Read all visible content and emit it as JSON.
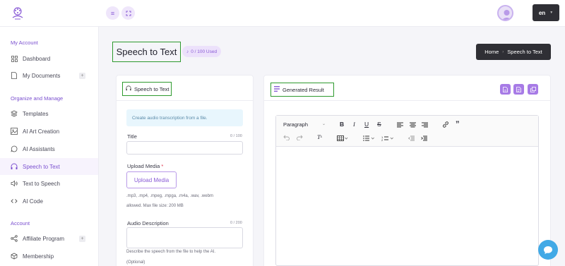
{
  "topbar": {
    "language": "en"
  },
  "sidebar": {
    "sections": [
      {
        "title": "My Account"
      },
      {
        "title": "Organize and Manage"
      },
      {
        "title": "Account"
      }
    ],
    "items": [
      {
        "label": "Dashboard",
        "icon": "grid-icon"
      },
      {
        "label": "My Documents",
        "icon": "document-icon",
        "expandable": true
      },
      {
        "label": "Templates",
        "icon": "layers-icon"
      },
      {
        "label": "AI Art Creation",
        "icon": "image-icon"
      },
      {
        "label": "AI Assistants",
        "icon": "chat-icon"
      },
      {
        "label": "Speech to Text",
        "icon": "headphones-icon",
        "active": true
      },
      {
        "label": "Text to Speech",
        "icon": "speaker-icon"
      },
      {
        "label": "AI Code",
        "icon": "code-icon"
      },
      {
        "label": "Affiliate Program",
        "icon": "share-icon",
        "expandable": true
      },
      {
        "label": "Membership",
        "icon": "box-icon"
      }
    ]
  },
  "header": {
    "title": "Speech to Text",
    "usage": "0 / 100 Used",
    "breadcrumb": {
      "home": "Home",
      "current": "Speech to Text"
    }
  },
  "form": {
    "card_title": "Speech to Text",
    "info": "Create audio transcription from a file.",
    "title_label": "Title",
    "title_counter": "0 / 100",
    "title_value": "",
    "upload_label": "Upload Media",
    "upload_required": "*",
    "upload_button": "Upload Media",
    "formats_hint": ".mp3, .mp4, .mpeg, .mpga, .m4a, .wav, .webm",
    "size_hint": "allowed. Max file size: 200 MB",
    "desc_label": "Audio Description",
    "desc_counter": "0 / 200",
    "desc_value": "",
    "desc_help": "Describe the speech from the file to help the AI.",
    "optional": "(Optional)"
  },
  "result": {
    "card_title": "Generated Result",
    "actions": [
      "word-doc-icon",
      "pdf-icon",
      "copy-icon"
    ],
    "editor": {
      "paragraph_select": "Paragraph"
    }
  },
  "colors": {
    "accent": "#8a5cd6",
    "highlight_border": "#2e9a2e",
    "dark_button": "#2f2f35",
    "info_bg": "#e8f6fd",
    "chat_bubble": "#41a9e6"
  }
}
